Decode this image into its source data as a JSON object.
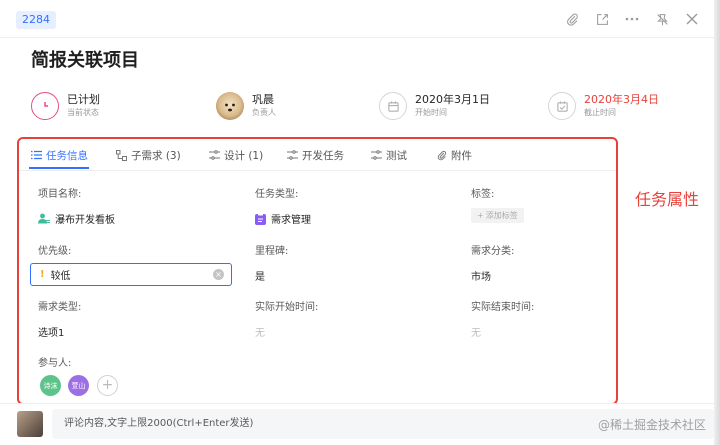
{
  "header": {
    "id_badge": "2284"
  },
  "title": "简报关联项目",
  "status_row": [
    {
      "value": "已计划",
      "label": "当前状态",
      "color": "#e84b8a"
    },
    {
      "value": "巩晨",
      "label": "负责人"
    },
    {
      "value": "2020年3月1日",
      "label": "开始时间"
    },
    {
      "value": "2020年3月4日",
      "label": "截止时间",
      "color": "#e8413a"
    }
  ],
  "tabs": [
    {
      "label": "任务信息",
      "icon": "list-icon",
      "active": true
    },
    {
      "label": "子需求 (3)",
      "icon": "subtask-icon"
    },
    {
      "label": "设计 (1)",
      "icon": "design-icon"
    },
    {
      "label": "开发任务",
      "icon": "dev-icon"
    },
    {
      "label": "测试",
      "icon": "test-icon"
    },
    {
      "label": "附件",
      "icon": "attachment-icon"
    }
  ],
  "fields": {
    "project_name": {
      "label": "项目名称:",
      "value": "瀑布开发看板"
    },
    "task_type": {
      "label": "任务类型:",
      "value": "需求管理"
    },
    "tags": {
      "label": "标签:",
      "add_label": "添加标签"
    },
    "priority": {
      "label": "优先级:",
      "value": "较低"
    },
    "milestone": {
      "label": "里程碑:",
      "value": "是"
    },
    "req_category": {
      "label": "需求分类:",
      "value": "市场"
    },
    "req_type": {
      "label": "需求类型:",
      "value": "选项1"
    },
    "actual_start": {
      "label": "实际开始时间:",
      "value": "无"
    },
    "actual_end": {
      "label": "实际结束时间:",
      "value": "无"
    },
    "participants": {
      "label": "参与人:",
      "people": [
        "诗沫",
        "萱山"
      ]
    }
  },
  "annotation": "任务属性",
  "comment": {
    "placeholder": "评论内容,文字上限2000(Ctrl+Enter发送)",
    "watermark": "@稀土掘金技术社区"
  },
  "colors": {
    "accent": "#3370ff",
    "highlight": "#e8413a"
  }
}
